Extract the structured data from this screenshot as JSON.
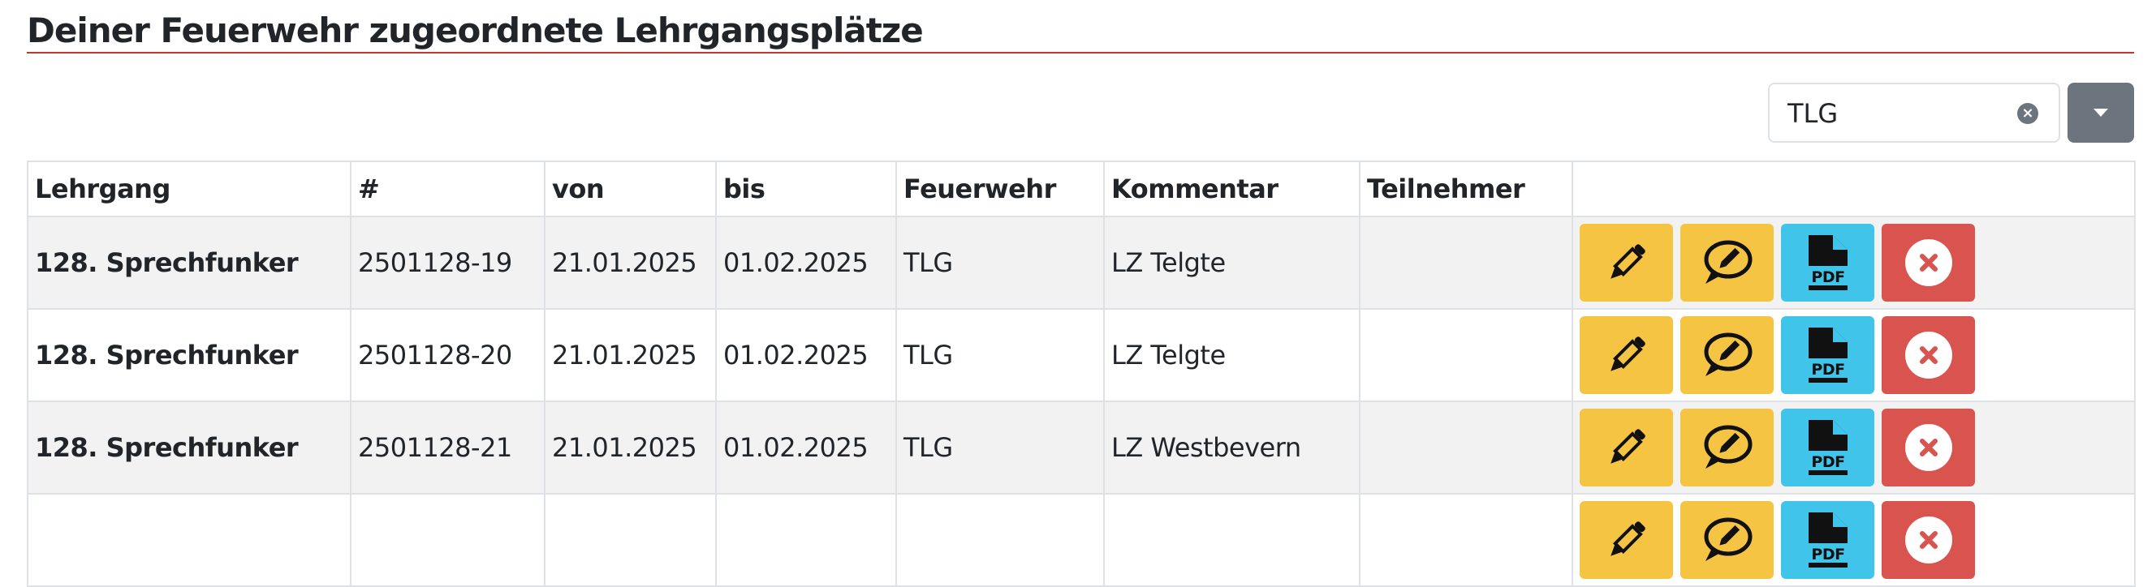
{
  "page": {
    "title": "Deiner Feuerwehr zugeordnete Lehrgangsplätze"
  },
  "filter": {
    "value": "TLG",
    "clear_icon": "×"
  },
  "table": {
    "headers": [
      "Lehrgang",
      "#",
      "von",
      "bis",
      "Feuerwehr",
      "Kommentar",
      "Teilnehmer",
      ""
    ],
    "rows": [
      {
        "course": "128. Sprechfunker",
        "number": "2501128-19",
        "from": "21.01.2025",
        "to": "01.02.2025",
        "brigade": "TLG",
        "comment": "LZ Telgte",
        "participant": ""
      },
      {
        "course": "128. Sprechfunker",
        "number": "2501128-20",
        "from": "21.01.2025",
        "to": "01.02.2025",
        "brigade": "TLG",
        "comment": "LZ Telgte",
        "participant": ""
      },
      {
        "course": "128. Sprechfunker",
        "number": "2501128-21",
        "from": "21.01.2025",
        "to": "01.02.2025",
        "brigade": "TLG",
        "comment": "LZ Westbevern",
        "participant": ""
      },
      {
        "course": "",
        "number": "",
        "from": "",
        "to": "",
        "brigade": "",
        "comment": "",
        "participant": ""
      }
    ],
    "actions": [
      {
        "icon": "pencil-icon",
        "color": "#f5c443"
      },
      {
        "icon": "comment-icon",
        "color": "#f5c443"
      },
      {
        "icon": "pdf-file-icon",
        "label": "PDF",
        "color": "#40c4ea"
      },
      {
        "icon": "close-circle-icon",
        "color": "#d9534f"
      }
    ]
  }
}
